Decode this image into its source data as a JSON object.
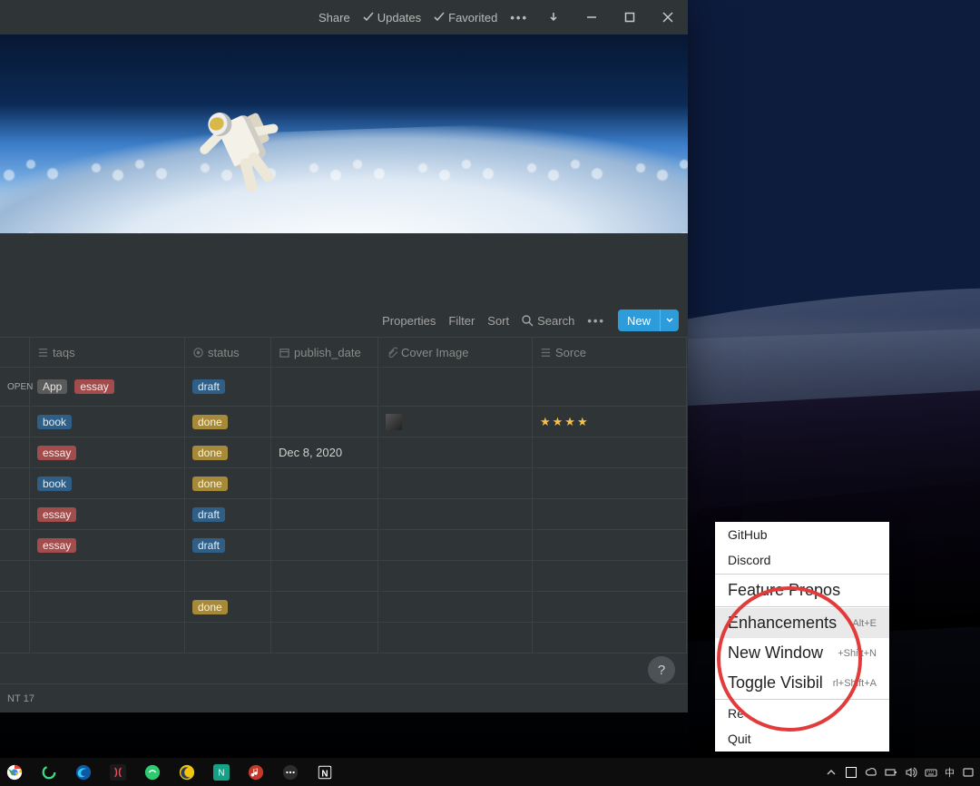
{
  "titlebar": {
    "share": "Share",
    "updates": "Updates",
    "favorited": "Favorited"
  },
  "toolbar": {
    "properties": "Properties",
    "filter": "Filter",
    "sort": "Sort",
    "search": "Search",
    "new": "New"
  },
  "columns": {
    "taqs": "taqs",
    "status": "status",
    "publish_date": "publish_date",
    "cover_image": "Cover Image",
    "sorce": "Sorce"
  },
  "rows": [
    {
      "open": "OPEN",
      "tags": [
        {
          "txt": "App",
          "cls": "tag-gray"
        },
        {
          "txt": "essay",
          "cls": "tag-red"
        }
      ],
      "status": {
        "txt": "draft",
        "cls": "tag-blueL"
      },
      "date": "",
      "cover": false,
      "stars": 0
    },
    {
      "tags": [
        {
          "txt": "book",
          "cls": "tag-blueL"
        }
      ],
      "status": {
        "txt": "done",
        "cls": "tag-yel"
      },
      "date": "",
      "cover": true,
      "stars": 4
    },
    {
      "tags": [
        {
          "txt": "essay",
          "cls": "tag-red"
        }
      ],
      "status": {
        "txt": "done",
        "cls": "tag-yel"
      },
      "date": "Dec 8, 2020",
      "cover": false,
      "stars": 0
    },
    {
      "tags": [
        {
          "txt": "book",
          "cls": "tag-blueL"
        }
      ],
      "status": {
        "txt": "done",
        "cls": "tag-yel"
      },
      "date": "",
      "cover": false,
      "stars": 0
    },
    {
      "tags": [
        {
          "txt": "essay",
          "cls": "tag-red"
        }
      ],
      "status": {
        "txt": "draft",
        "cls": "tag-blueL"
      },
      "date": "",
      "cover": false,
      "stars": 0
    },
    {
      "tags": [
        {
          "txt": "essay",
          "cls": "tag-red"
        }
      ],
      "status": {
        "txt": "draft",
        "cls": "tag-blueL"
      },
      "date": "",
      "cover": false,
      "stars": 0
    },
    {
      "tags": [],
      "status": null,
      "date": "",
      "cover": false,
      "stars": 0
    },
    {
      "tags": [],
      "status": {
        "txt": "done",
        "cls": "tag-yel"
      },
      "date": "",
      "cover": false,
      "stars": 0
    }
  ],
  "footer": {
    "count_label": "NT",
    "count": "17"
  },
  "help": "?",
  "ctx": {
    "items": [
      {
        "label": "GitHub",
        "big": false
      },
      {
        "label": "Discord",
        "big": false
      },
      {
        "label": "Feature Propos",
        "big": true,
        "sep_before": true
      },
      {
        "label": "Enhancements",
        "big": true,
        "kb": "Alt+E",
        "hi": true,
        "sep_before": true
      },
      {
        "label": "New Window",
        "big": true,
        "kb": "+Shift+N"
      },
      {
        "label": "Toggle Visibil",
        "big": true,
        "kb": "rl+Shift+A",
        "sep_after": true
      },
      {
        "label": "Re",
        "big": false
      },
      {
        "label": "Quit",
        "big": false
      }
    ]
  },
  "tray": {
    "ime": "中"
  }
}
